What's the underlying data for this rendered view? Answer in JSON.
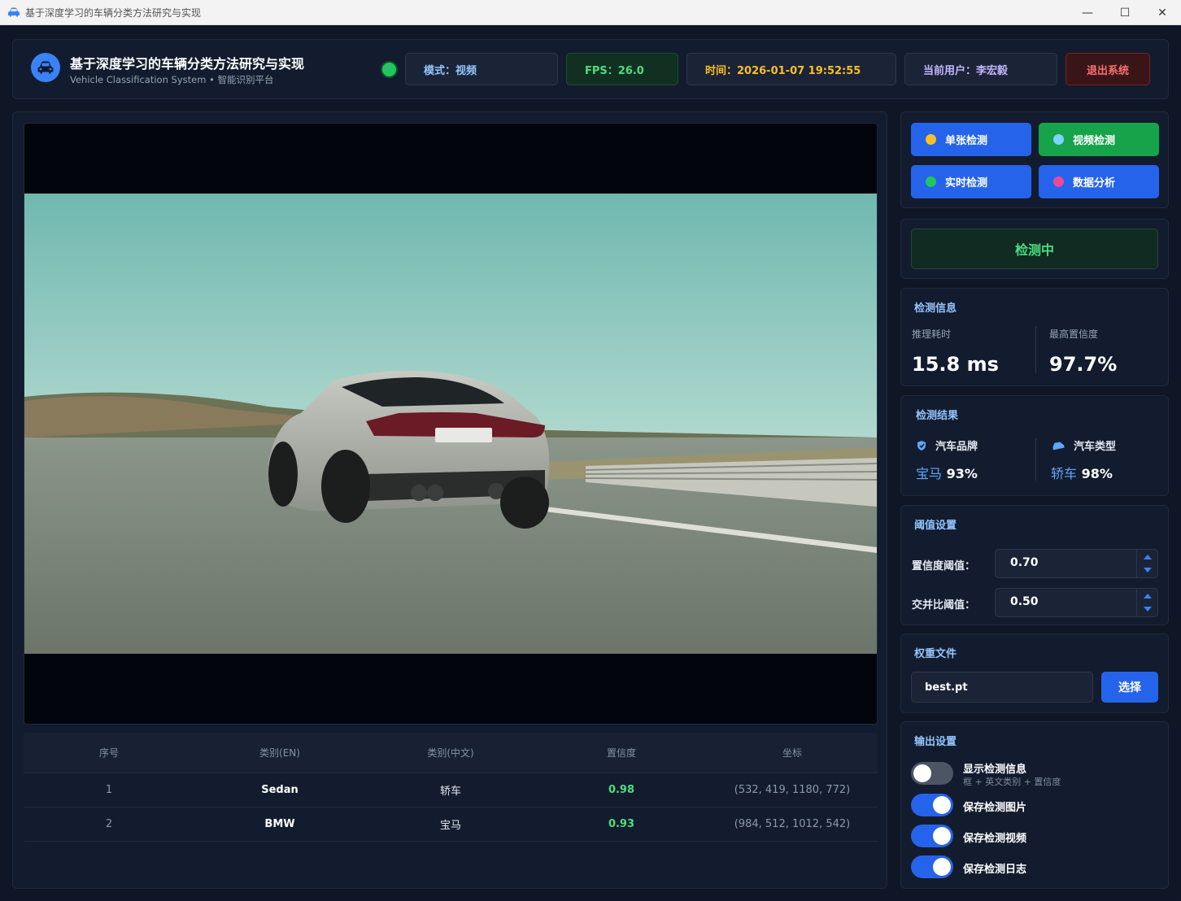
{
  "window": {
    "title": "基于深度学习的车辆分类方法研究与实现",
    "controls": {
      "minimize": "—",
      "maximize": "☐",
      "close": "✕"
    }
  },
  "header": {
    "title": "基于深度学习的车辆分类方法研究与实现",
    "subtitle": "Vehicle Classification System • 智能识别平台",
    "mode": "模式：视频",
    "fps": "FPS：26.0",
    "time": "时间：2026-01-07 19:52:55",
    "user": "当前用户：李宏毅",
    "logout": "退出系统"
  },
  "nav": {
    "single": "单张检测",
    "video": "视频检测",
    "realtime": "实时检测",
    "analysis": "数据分析"
  },
  "status": {
    "label": "检测中"
  },
  "info": {
    "title": "检测信息",
    "infer_label": "推理耗时",
    "infer_value": "15.8 ms",
    "conf_label": "最高置信度",
    "conf_value": "97.7%"
  },
  "result": {
    "title": "检测结果",
    "brand_label": "汽车品牌",
    "brand_name": "宝马",
    "brand_conf": "93%",
    "type_label": "汽车类型",
    "type_name": "轿车",
    "type_conf": "98%"
  },
  "threshold": {
    "title": "阈值设置",
    "conf_label": "置信度阈值：",
    "conf_value": "0.70",
    "iou_label": "交并比阈值：",
    "iou_value": "0.50"
  },
  "weights": {
    "title": "权重文件",
    "file": "best.pt",
    "choose": "选择"
  },
  "output": {
    "title": "输出设置",
    "show_info": "显示检测信息",
    "show_info_sub": "框 + 英文类别 + 置信度",
    "save_image": "保存检测图片",
    "save_video": "保存检测视频",
    "save_log": "保存检测日志",
    "states": {
      "show_info": false,
      "save_image": true,
      "save_video": true,
      "save_log": true
    }
  },
  "table": {
    "headers": [
      "序号",
      "类别(EN)",
      "类别(中文)",
      "置信度",
      "坐标"
    ],
    "rows": [
      [
        "1",
        "Sedan",
        "轿车",
        "0.98",
        "(532, 419, 1180, 772)"
      ],
      [
        "2",
        "BMW",
        "宝马",
        "0.93",
        "(984, 512, 1012, 542)"
      ]
    ]
  },
  "colors": {
    "accent": "#2563eb",
    "success": "#16a34a",
    "danger": "#f87171",
    "warning": "#fbbf24",
    "bg": "#0f1626"
  }
}
